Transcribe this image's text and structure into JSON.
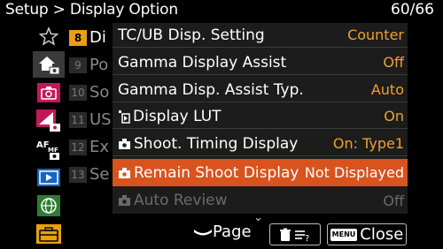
{
  "header": {
    "breadcrumb": "Setup > Display Option",
    "page_count": "60/66"
  },
  "categories": [
    {
      "icon": "star-icon",
      "active": false
    },
    {
      "icon": "home-camera-icon",
      "active": true
    },
    {
      "icon": "camera-icon",
      "active": false
    },
    {
      "icon": "exposure-camera-icon",
      "active": false
    },
    {
      "icon": "af-mf-icon",
      "active": false
    },
    {
      "icon": "playback-icon",
      "active": false
    },
    {
      "icon": "network-globe-icon",
      "active": false
    },
    {
      "icon": "toolbox-icon",
      "active": false
    }
  ],
  "subpages": [
    {
      "num": "8",
      "label": "Di",
      "active": true
    },
    {
      "num": "9",
      "label": "Po",
      "active": false
    },
    {
      "num": "10",
      "label": "So",
      "active": false
    },
    {
      "num": "11",
      "label": "US",
      "active": false
    },
    {
      "num": "12",
      "label": "Ex",
      "active": false
    },
    {
      "num": "13",
      "label": "Se",
      "active": false
    }
  ],
  "menu": {
    "items": [
      {
        "label": "TC/UB Disp. Setting",
        "value": "Counter"
      },
      {
        "label": "Gamma Display Assist",
        "value": "Off"
      },
      {
        "label": "Gamma Disp. Assist Typ.",
        "value": "Auto"
      },
      {
        "label": "Display LUT",
        "value": "On",
        "icon": "movie-icon"
      },
      {
        "label": "Shoot. Timing Display",
        "value": "On: Type1",
        "icon": "camera-small-icon"
      },
      {
        "label": "Remain Shoot Display",
        "value": "Not Displayed",
        "icon": "camera-small-icon",
        "selected": true
      },
      {
        "label": "Auto Review",
        "value": "Off",
        "icon": "camera-small-icon",
        "dimmed": true
      }
    ]
  },
  "footer": {
    "page_label": "Page",
    "close_label": "Close",
    "menu_key_label": "MENU"
  },
  "colors": {
    "accent": "#d9531e",
    "value_orange": "#f0a030",
    "subpage_active": "#e8a010"
  }
}
